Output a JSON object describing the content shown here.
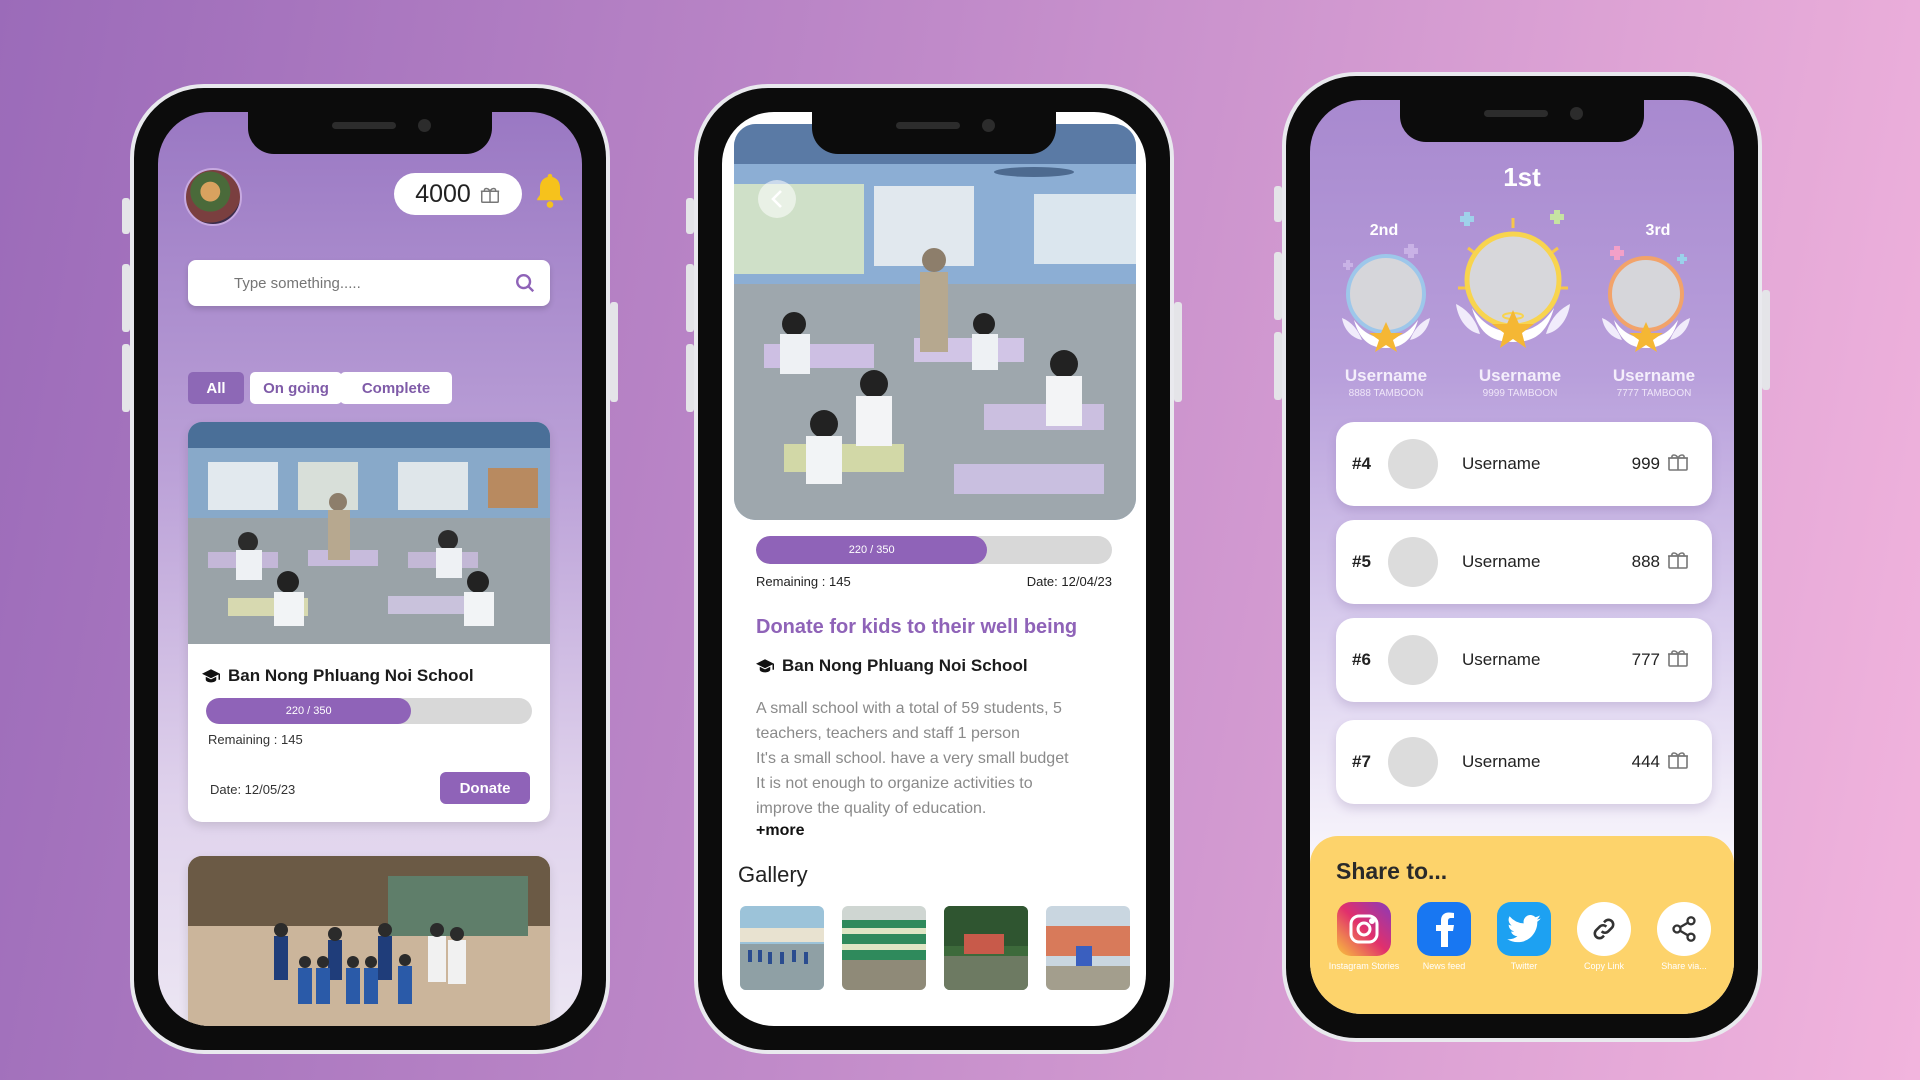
{
  "colors": {
    "accent": "#8f63b8",
    "bell": "#f6c21c",
    "share_bg": "#fdd36b"
  },
  "home": {
    "coins": "4000",
    "search_placeholder": "Type something.....",
    "filters": [
      "All",
      "On going",
      "Complete"
    ],
    "card": {
      "school": "Ban Nong Phluang Noi School",
      "progress_text": "220 / 350",
      "progress_fraction": 0.63,
      "remaining": "Remaining : 145",
      "date": "Date: 12/05/23",
      "donate": "Donate"
    }
  },
  "detail": {
    "progress_text": "220 / 350",
    "progress_fraction": 0.65,
    "remaining": "Remaining : 145",
    "date": "Date: 12/04/23",
    "heading": "Donate for kids to their well being",
    "school": "Ban Nong Phluang Noi School",
    "description_lines": [
      "A small school with a total of 59 students, 5",
      "teachers, teachers and staff 1 person",
      "It's a small school. have a very small budget",
      "It is not enough to organize activities to",
      "improve the quality of education."
    ],
    "more": "+more",
    "gallery_title": "Gallery"
  },
  "leaderboard": {
    "first_label": "1st",
    "second_label": "2nd",
    "third_label": "3rd",
    "podium": {
      "second": {
        "name": "Username",
        "points": "8888 TAMBOON"
      },
      "first": {
        "name": "Username",
        "points": "9999 TAMBOON"
      },
      "third": {
        "name": "Username",
        "points": "7777 TAMBOON"
      }
    },
    "rows": [
      {
        "rank": "#4",
        "name": "Username",
        "score": "999"
      },
      {
        "rank": "#5",
        "name": "Username",
        "score": "888"
      },
      {
        "rank": "#6",
        "name": "Username",
        "score": "777"
      },
      {
        "rank": "#7",
        "name": "Username",
        "score": "444"
      }
    ],
    "share_title": "Share to...",
    "share_items": [
      {
        "label": "Instagram Stories",
        "icon": "instagram-icon"
      },
      {
        "label": "News feed",
        "icon": "facebook-icon"
      },
      {
        "label": "Twitter",
        "icon": "twitter-icon"
      },
      {
        "label": "Copy Link",
        "icon": "link-icon"
      },
      {
        "label": "Share via...",
        "icon": "share-icon"
      }
    ]
  }
}
